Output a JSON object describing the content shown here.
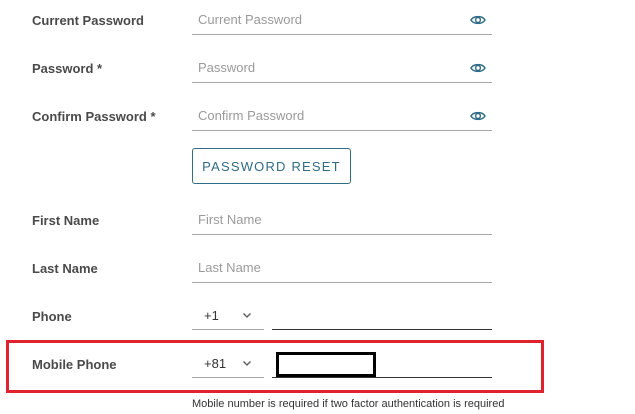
{
  "form": {
    "current_password": {
      "label": "Current Password",
      "placeholder": "Current Password",
      "value": ""
    },
    "password": {
      "label": "Password *",
      "placeholder": "Password",
      "value": ""
    },
    "confirm_password": {
      "label": "Confirm Password *",
      "placeholder": "Confirm Password",
      "value": ""
    },
    "password_reset_button": "PASSWORD RESET",
    "first_name": {
      "label": "First Name",
      "placeholder": "First Name",
      "value": ""
    },
    "last_name": {
      "label": "Last Name",
      "placeholder": "Last Name",
      "value": ""
    },
    "phone": {
      "label": "Phone",
      "country_code": "+1",
      "number": ""
    },
    "mobile_phone": {
      "label": "Mobile Phone",
      "country_code": "+81",
      "number": "",
      "hint": "Mobile number is required if two factor authentication is required"
    }
  },
  "icons": {
    "visibility_toggle": "eye-icon",
    "dropdown": "chevron-down-icon"
  },
  "colors": {
    "accent": "#2e6c87",
    "highlight": "#e0222e",
    "label": "#4a4a4a",
    "placeholder": "#9a9a9a",
    "underline": "#a8a8a8"
  }
}
